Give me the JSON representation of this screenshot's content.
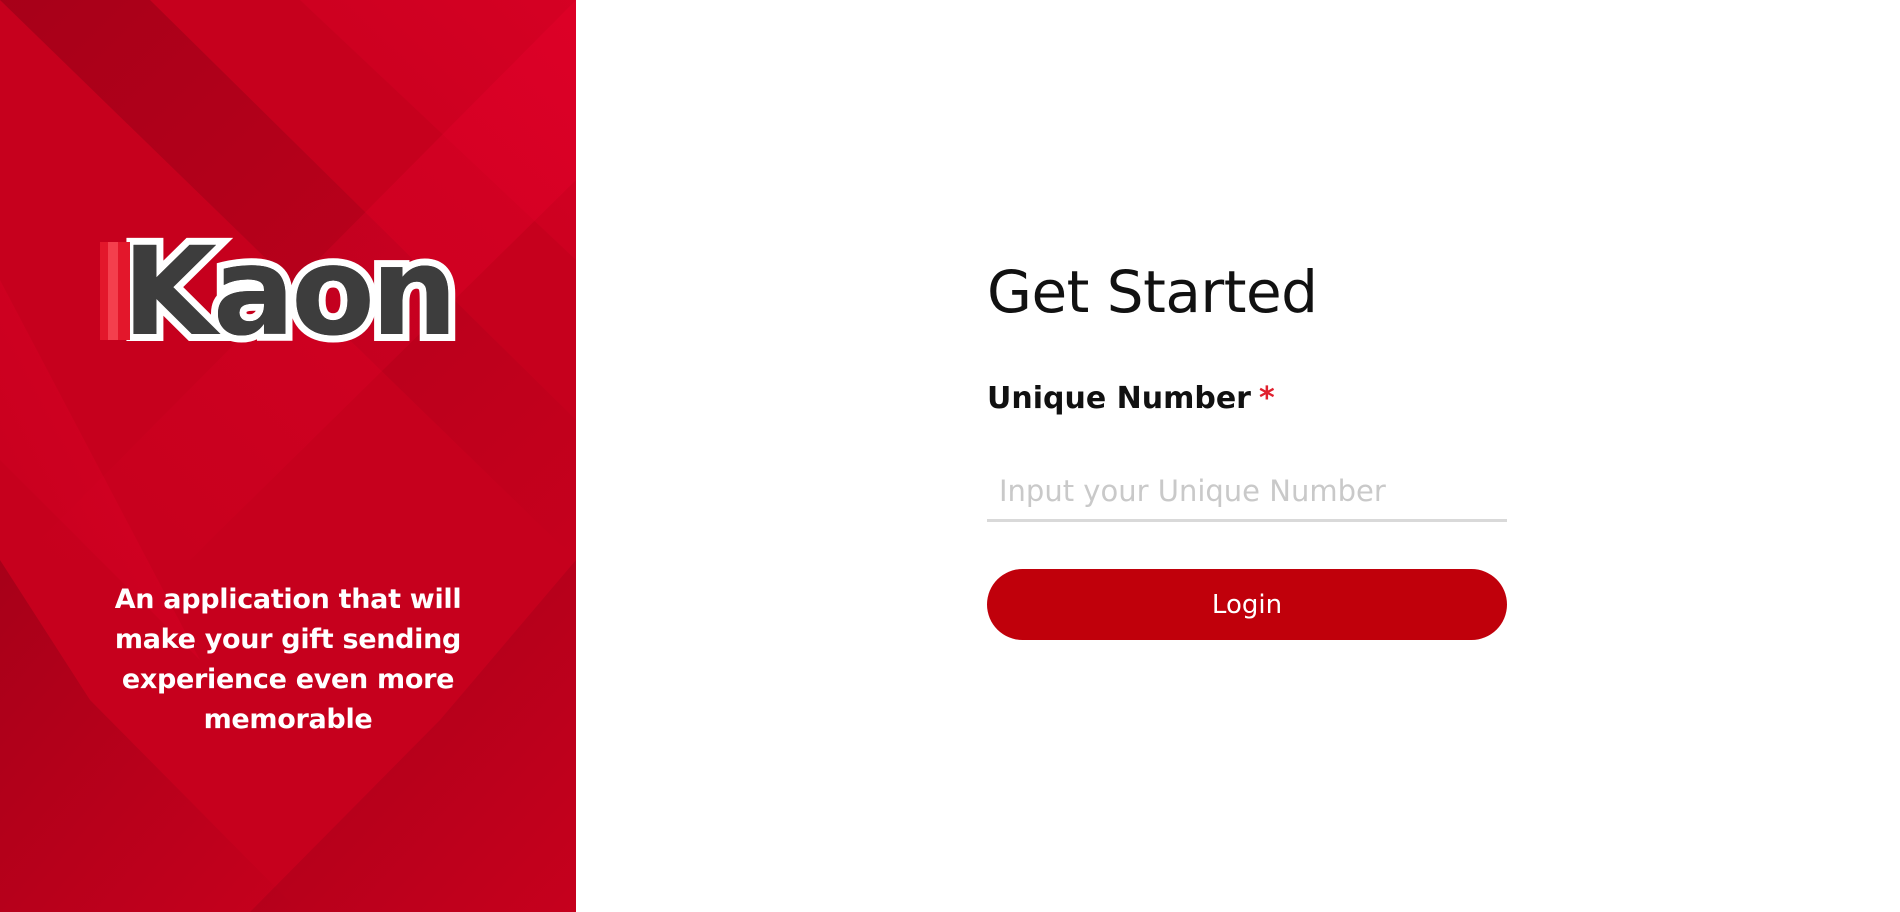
{
  "brand": {
    "logo_text": "Kaon",
    "tagline": "An application that will make your gift sending experience even more memorable",
    "panel_color": "#c8001c"
  },
  "form": {
    "title": "Get Started",
    "field_label": "Unique Number",
    "required_marker": "*",
    "input_placeholder": "Input your Unique Number",
    "input_value": "",
    "login_label": "Login",
    "accent_color": "#c0000b"
  }
}
